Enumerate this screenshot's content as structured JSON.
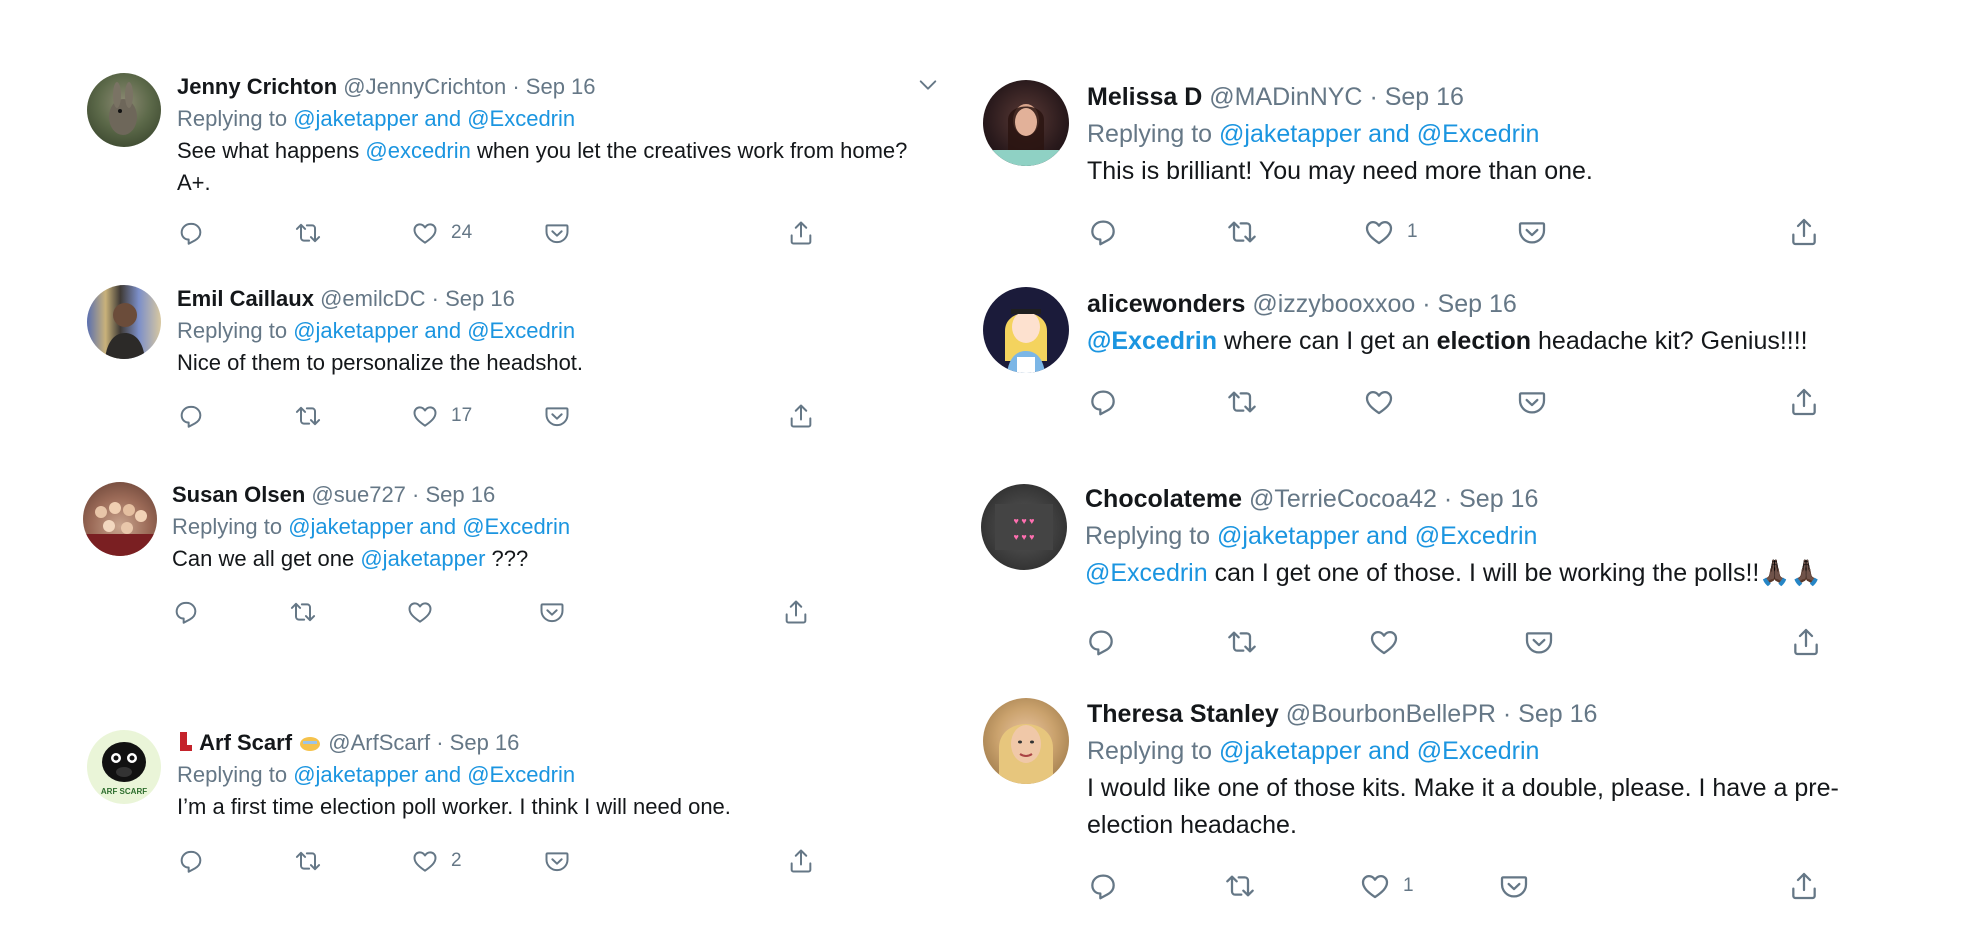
{
  "tweets": [
    {
      "name": "Jenny Crichton",
      "handle": "@JennyCrichton",
      "date": "· Sep 16",
      "replying_prefix": "Replying to",
      "replying_to": "@jaketapper and @Excedrin",
      "text_1": "See what happens ",
      "mention": "@excedrin",
      "text_2": " when you let the creatives work from home?",
      "text_3": "A+.",
      "likes": "24",
      "icons": [
        "reply-icon",
        "retweet-icon",
        "heart-icon",
        "pocket-icon",
        "share-icon"
      ]
    },
    {
      "name": "Emil Caillaux",
      "handle": "@emilcDC",
      "date": "· Sep 16",
      "replying_prefix": "Replying to",
      "replying_to": "@jaketapper and @Excedrin",
      "text_1": "Nice of them to personalize the headshot.",
      "likes": "17"
    },
    {
      "name": "Susan Olsen",
      "handle": "@sue727",
      "date": "· Sep 16",
      "replying_prefix": "Replying to",
      "replying_to": "@jaketapper and @Excedrin",
      "text_1": "Can we all get one ",
      "mention": "@jaketapper",
      "text_2": " ???",
      "likes": ""
    },
    {
      "name": "Arf Scarf",
      "handle": "@ArfScarf",
      "date": "· Sep 16",
      "replying_prefix": "Replying to",
      "replying_to": "@jaketapper and @Excedrin",
      "text_1": "I’m a first time election poll worker.  I think I will need one.",
      "likes": "2",
      "avatar_text": "ARF SCARF"
    },
    {
      "name": "Melissa D",
      "handle": "@MADinNYC",
      "date": "· Sep 16",
      "replying_prefix": "Replying to",
      "replying_to": "@jaketapper and @Excedrin",
      "text_1": "This is brilliant! You may need more than one.",
      "likes": "1"
    },
    {
      "name": "alicewonders",
      "handle": "@izzybooxxoo",
      "date": "· Sep 16",
      "mention": "@Excedrin",
      "text_1": " where can I get an ",
      "bold": "election",
      "text_2": " headache kit?  Genius!!!!",
      "likes": ""
    },
    {
      "name": "Chocolateme",
      "handle": "@TerrieCocoa42",
      "date": "· Sep 16",
      "replying_prefix": "Replying to",
      "replying_to": "@jaketapper and @Excedrin",
      "mention": "@Excedrin",
      "text_1": " can I get one of those. I will be working the polls!!",
      "emoji": "🙏🏿🙏🏿",
      "likes": ""
    },
    {
      "name": "Theresa Stanley",
      "handle": "@BourbonBellePR",
      "date": "· Sep 16",
      "replying_prefix": "Replying to",
      "replying_to": "@jaketapper and @Excedrin",
      "text_1": "I would like one of those kits. Make it a double, please. I have a pre-",
      "text_2": "election headache.",
      "likes": "1"
    }
  ]
}
